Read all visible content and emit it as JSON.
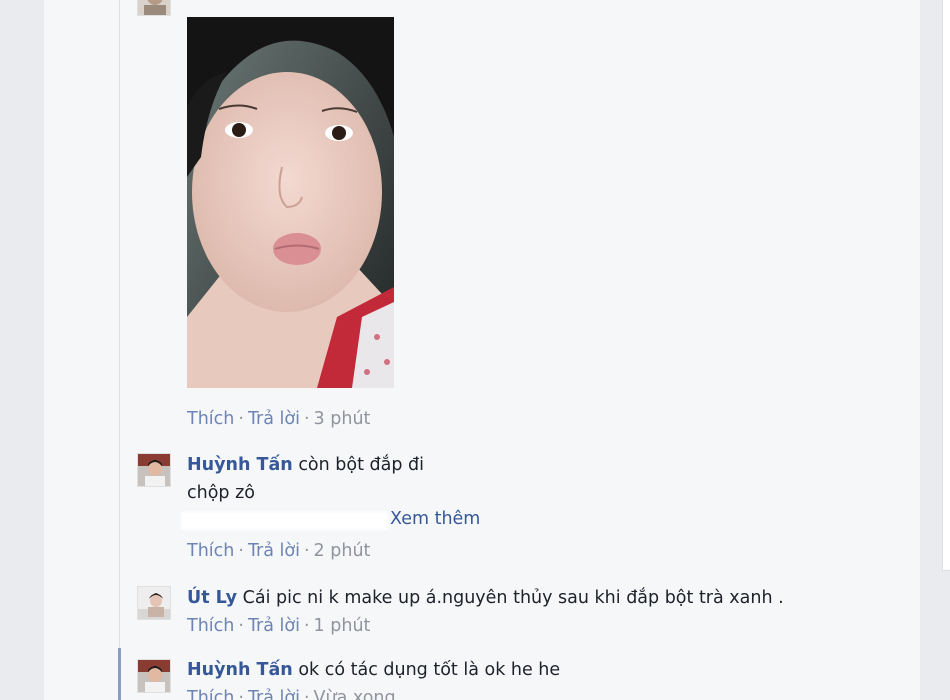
{
  "comments": [
    {
      "actions": {
        "like": "Thích",
        "reply": "Trả lời",
        "time": "3 phút"
      }
    },
    {
      "author": "Huỳnh Tấn",
      "text_line1": "còn bột đắp đi",
      "text_line2": "chộp zô",
      "see_more": "Xem thêm",
      "actions": {
        "like": "Thích",
        "reply": "Trả lời",
        "time": "2 phút"
      }
    },
    {
      "author": "Út Ly",
      "text": "Cái pic ni k make up á.nguyên thủy sau khi đắp bột trà xanh .",
      "actions": {
        "like": "Thích",
        "reply": "Trả lời",
        "time": "1 phút"
      }
    },
    {
      "author": "Huỳnh Tấn",
      "text": "ok có tác dụng tốt là ok he he",
      "actions": {
        "like": "Thích",
        "reply": "Trả lời",
        "time": "Vừa xong"
      }
    }
  ],
  "colors": {
    "name": "#365899",
    "meta": "#90949c",
    "background": "#f6f7f9",
    "thread_line": "#dddfe2"
  },
  "icons": [
    "avatar-huynh-tan",
    "avatar-ut-ly",
    "comment-photo"
  ]
}
